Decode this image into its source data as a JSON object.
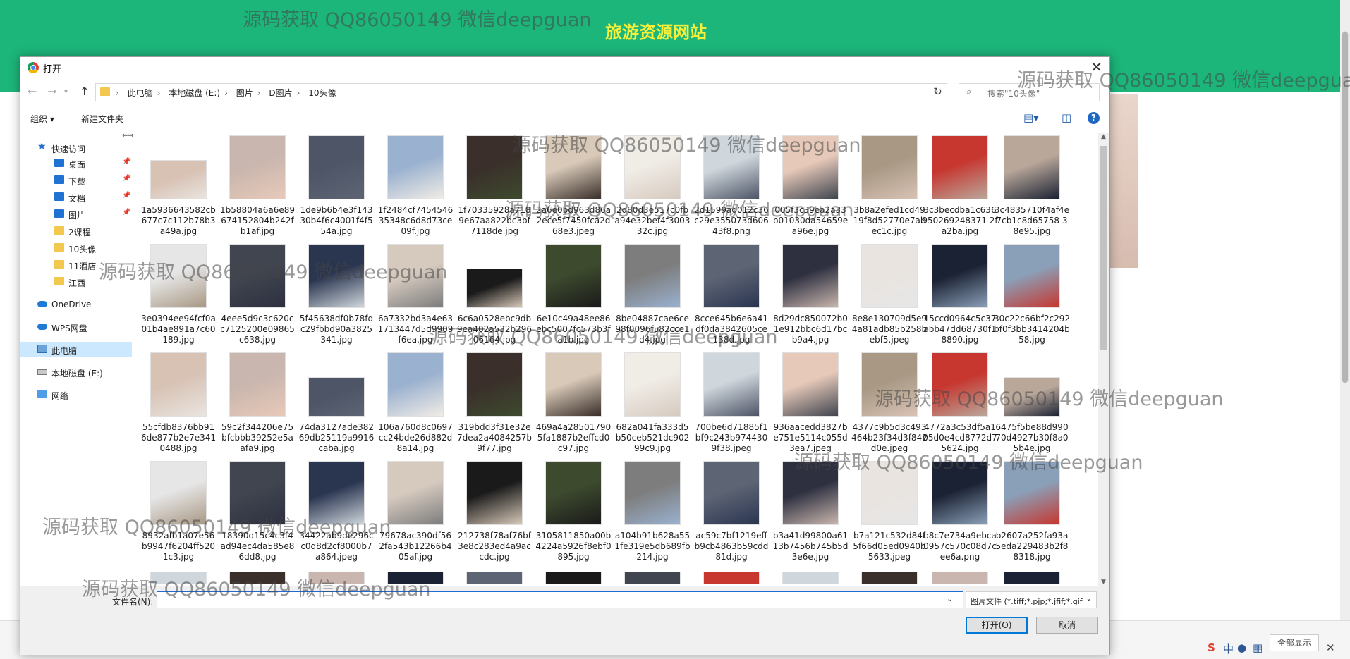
{
  "banner": {
    "title": "旅游资源网站",
    "color": "#1cb57a"
  },
  "dialog": {
    "title": "打开",
    "close_icon": "close-icon",
    "breadcrumb": [
      "此电脑",
      "本地磁盘 (E:)",
      "图片",
      "D图片",
      "10头像"
    ],
    "search_placeholder": "搜索\"10头像\"",
    "toolbar": {
      "organize": "组织 ▾",
      "new_folder": "新建文件夹",
      "help": "?"
    },
    "nav": [
      {
        "label": "快速访问",
        "icon": "star-icon",
        "pin": false
      },
      {
        "label": "桌面",
        "icon": "desktop-icon",
        "pin": true
      },
      {
        "label": "下载",
        "icon": "download-icon",
        "pin": true
      },
      {
        "label": "文档",
        "icon": "document-icon",
        "pin": true
      },
      {
        "label": "图片",
        "icon": "pictures-icon",
        "pin": true
      },
      {
        "label": "2课程",
        "icon": "folder-icon",
        "pin": false
      },
      {
        "label": "10头像",
        "icon": "folder-icon",
        "pin": false
      },
      {
        "label": "11酒店",
        "icon": "folder-icon",
        "pin": false
      },
      {
        "label": "江西",
        "icon": "folder-icon",
        "pin": false
      },
      {
        "label": "OneDrive",
        "icon": "cloud-icon",
        "pin": false
      },
      {
        "label": "WPS网盘",
        "icon": "cloud-icon",
        "pin": false
      },
      {
        "label": "此电脑",
        "icon": "pc-icon",
        "pin": false,
        "selected": true
      },
      {
        "label": "本地磁盘 (E:)",
        "icon": "disk-icon",
        "pin": false
      },
      {
        "label": "网络",
        "icon": "network-icon",
        "pin": false
      }
    ],
    "files": [
      "1a5936643582cb677c7c112b78b3a49a.jpg",
      "1b58804a6a6e89674152804b242fb1af.jpg",
      "1de9b6b4e3f14330b4f6c4001f4f554a.jpg",
      "1f2484cf745454635348c6d8d73ce09f.jpg",
      "1f70335928a7189e67aa822bc3bf7118de.jpg",
      "2a6e0bd963d86a2ece5f7450fca2d68e3.jpeg",
      "2d80d3e517c0fba94e32bef4f300332c.jpg",
      "2d1599ad012c36c29e355073d60643f8.png",
      "005f3c39ea2a33b01030da54659ea96e.jpg",
      "3b8a2efed1cd4919f8d52770e7abec1c.jpg",
      "3c3becdba1c636950269248371 2fa2ba.jpg",
      "3c4835710f4af4e7cb1c8d65758 38e95.jpg",
      "3e0394ee94fcf0a01b4ae891a7c60189.jpg",
      "4eee5d9c3c620cc7125200e09865c638.jpg",
      "5f45638df0b78fdc29fbbd90a3825341.jpg",
      "6a7332bd3a4e631713447d5d9909f6ea.jpg",
      "6c6a0528ebc9db9ea402a532b29606164.jpg",
      "6e10c49a48ee86ebc5007fc573b3fa1b.jpg",
      "8be04887cae6ce98f0096f582cce1d4.jpg",
      "8cce645b6e6a41df0da3842605ce138d.jpg",
      "8d29dc850072b01e912bbc6d17bcb9a4.jpg",
      "8e8e130709d5e94a81adb85b258bebf5.jpeg",
      "15ccd0964c5c37abb47dd68730f18890.jpg",
      "30c22c66bf2c292bf0f3bb3414204b58.jpg",
      "55cfdb8376bb916de877b2e7e3410488.jpg",
      "59c2f344206e75bfcbbb39252e5aafa9.jpg",
      "74da3127ade38269db25119a9916caba.jpg",
      "106a760d8c0697cc24bde26d882d8a14.jpg",
      "319bdd3f31e32e7dea2a4084257b9f77.jpg",
      "469a4a285017905fa1887b2effcd0c97.jpg",
      "682a041fa333d5b50ceb521dc90299c9.jpg",
      "700be6d71885f1bf9c243b9744309f38.jpeg",
      "936aacedd3827be751e5114c055d3ea7.jpeg",
      "4377c9b5d3c493464b23f34d3f842d0e.jpeg",
      "4772a3c53df5a105d0e4cd8772d75624.jpg",
      "6475f5be88d99070d4927b30f8a05b4e.jpg",
      "8932afb1a07e56b9947f6204ff5201c3.jpg",
      "18390d15c4c3f4ad94ec4da585e86dd8.jpg",
      "34422ab9de296cc0d8d2cf8000b7a864.jpeg",
      "79678ac390df562fa543b12266b405af.jpg",
      "212738f78af76bf3e8c283ed4a9accdc.jpg",
      "3105811850a00b4224a5926f8ebf0895.jpg",
      "a104b91b628a551fe319e5db689fb214.jpg",
      "ac59c7bf1219effb9cb4863b59cdd81d.jpg",
      "b3a41d99800a6113b7456b745b5d3e6e.jpg",
      "b7a121c532d84f5f66d05ed0940b5633.jpeg",
      "b8c7e734a9ebca0957c570c08d7cee6a.png",
      "b2607a252fa93a5eda229483b2f88318.jpg"
    ],
    "footer": {
      "filename_label": "文件名(N):",
      "filename_value": "",
      "filter": "图片文件 (*.tiff;*.pjp;*.jfif;*.gif;",
      "open_button": "打开(O)",
      "cancel_button": "取消"
    }
  },
  "watermark": "源码获取 QQ86050149 微信deepguan",
  "taskbar": {
    "show_all": "全部显示"
  }
}
